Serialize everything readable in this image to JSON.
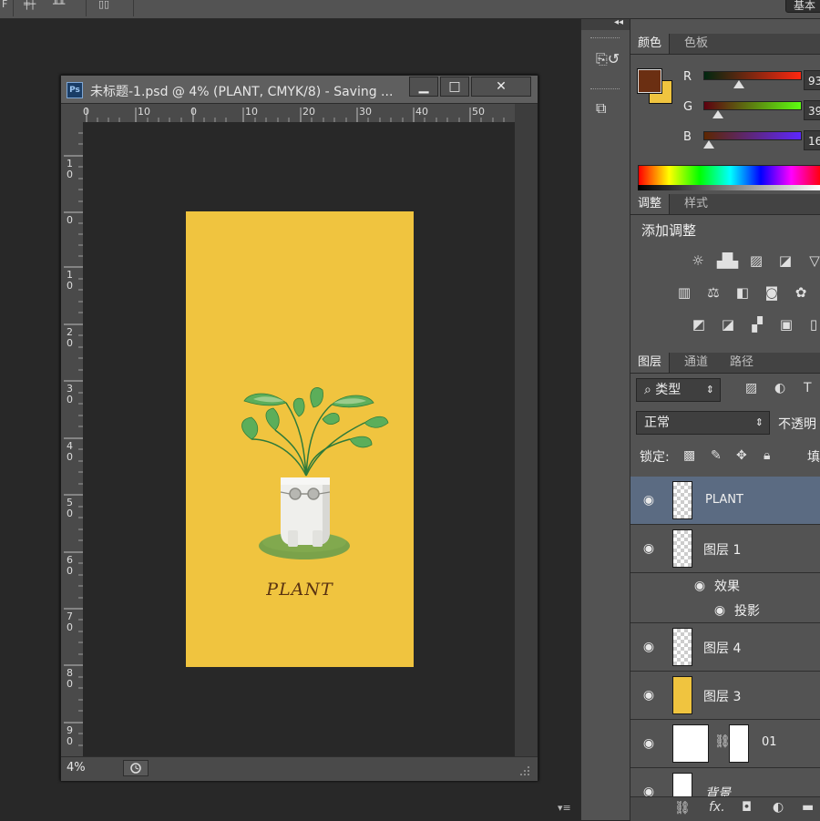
{
  "document": {
    "title": "未标题-1.psd @ 4% (PLANT, CMYK/8) - Saving ...",
    "zoom": "4%",
    "ruler_h_labels": [
      "0",
      "10",
      "0",
      "10",
      "20",
      "30",
      "40",
      "50"
    ],
    "ruler_v_labels": [
      "10",
      "0",
      "10",
      "20",
      "30",
      "40",
      "50",
      "60",
      "70",
      "80",
      "90"
    ],
    "artwork_text": "PLANT",
    "artboard_color": "#f0c43f"
  },
  "topbar": {
    "workspace_label": "基本"
  },
  "color_panel": {
    "tabs": [
      "颜色",
      "色板"
    ],
    "foreground": "#6b2f12",
    "background": "#f0c43f",
    "sliders": [
      {
        "label": "R",
        "value": "93",
        "level": 0.37
      },
      {
        "label": "G",
        "value": "39",
        "level": 0.15
      },
      {
        "label": "B",
        "value": "16",
        "level": 0.06
      }
    ]
  },
  "adjustments_panel": {
    "tabs": [
      "调整",
      "样式"
    ],
    "heading": "添加调整",
    "icons": [
      [
        "brightness-icon",
        "levels-icon",
        "curves-icon",
        "exposure-icon",
        "vibrance-icon"
      ],
      [
        "hue-saturation-icon",
        "color-balance-icon",
        "black-white-icon",
        "photo-filter-icon",
        "channel-mixer-icon"
      ],
      [
        "invert-icon",
        "posterize-icon",
        "threshold-icon",
        "gradient-map-icon",
        "selective-color-icon"
      ]
    ]
  },
  "layers_panel": {
    "tabs": [
      "图层",
      "通道",
      "路径"
    ],
    "filter_label": "类型",
    "blend_mode": "正常",
    "opacity_label": "不透明",
    "lock_label": "锁定:",
    "fill_label": "填",
    "layers": [
      {
        "name": "PLANT",
        "selected": true
      },
      {
        "name": "图层 1",
        "selected": false
      },
      {
        "name": "效果",
        "sub": true
      },
      {
        "name": "投影",
        "sub2": true
      },
      {
        "name": "图层 4",
        "selected": false
      },
      {
        "name": "图层 3",
        "selected": false
      },
      {
        "name": "01",
        "selected": false
      },
      {
        "name": "背景",
        "selected": false
      }
    ]
  }
}
